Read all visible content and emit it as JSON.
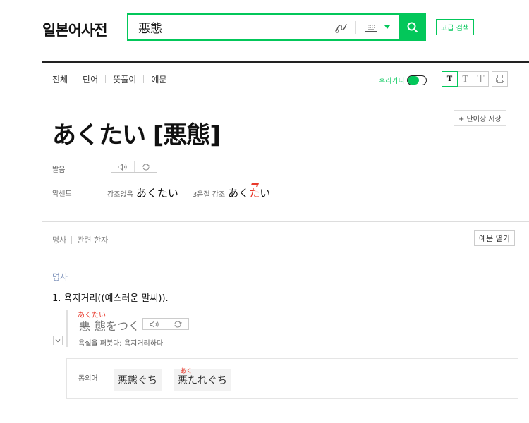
{
  "header": {
    "logo": "일본어사전",
    "search": {
      "value": "悪態"
    },
    "advanced_search_label": "고급 검색"
  },
  "tabs": [
    {
      "label": "전체"
    },
    {
      "label": "단어"
    },
    {
      "label": "뜻풀이"
    },
    {
      "label": "예문"
    }
  ],
  "view_options": {
    "furigana_label": "후리가나",
    "furigana_on": true,
    "font_sizes": [
      "T",
      "T",
      "T"
    ],
    "selected_size_index": 0
  },
  "entry": {
    "title": "あくたい [悪態]",
    "save_label": "+ 단어장 저장",
    "pronunciation_label": "발음",
    "audio_play_icon": "speaker-icon",
    "audio_repeat_icon": "repeat-icon",
    "accent_label": "악센트",
    "accent_none_label": "강조없음",
    "accent_none_word": "あくたい",
    "accent_third_label": "3음절 강조",
    "accent_third_prefix": "あく",
    "accent_third_mark": "た",
    "accent_third_suffix": "い"
  },
  "section_tabs": [
    "명사",
    "관련 한자"
  ],
  "examples_button": "예문 열기",
  "meaning": {
    "pos": "명사",
    "sense": "1.  욕지거리((예스러운 말씨)).",
    "example": {
      "ruby": "あくたい",
      "kanji_1": "悪",
      "kanji_2": "態",
      "kana": "をつく",
      "translation": "욕설을 퍼붓다; 욕지거리하다"
    }
  },
  "synonyms": {
    "label": "동의어",
    "items": [
      {
        "text": "悪態ぐち",
        "ruby": ""
      },
      {
        "text": "悪たれぐち",
        "ruby": "あく"
      }
    ]
  },
  "colors": {
    "accent_green": "#03c75a",
    "accent_red": "#e8392b",
    "pos_blue": "#7a8fb8"
  }
}
